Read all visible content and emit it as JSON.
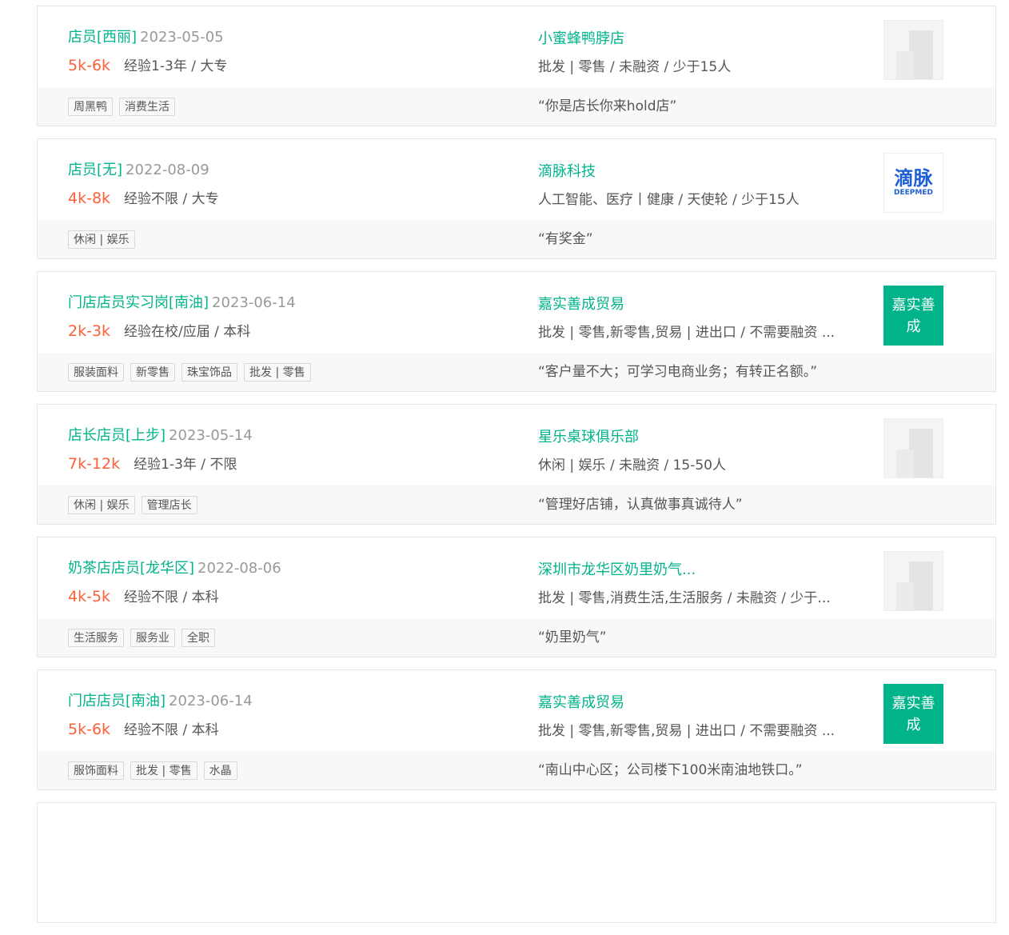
{
  "colors": {
    "accent": "#00b38a",
    "salary": "#fd5f39",
    "muted": "#999999",
    "text": "#555555",
    "tag_border": "#d8d8d8"
  },
  "jobs": [
    {
      "title": "店员[西丽]",
      "date": "2023-05-05",
      "salary": "5k-6k",
      "requirements": "经验1-3年 / 大专",
      "company": "小蜜蜂鸭脖店",
      "industry": "批发 | 零售 / 未融资 / 少于15人",
      "logo_type": "placeholder",
      "logo_icon": "company-logo-placeholder-icon",
      "tags": [
        "周黑鸭",
        "消费生活"
      ],
      "slogan": "“你是店长你来hold店”"
    },
    {
      "title": "店员[无]",
      "date": "2022-08-09",
      "salary": "4k-8k",
      "requirements": "经验不限 / 大专",
      "company": "滴脉科技",
      "industry": "人工智能、医疗丨健康 / 天使轮 / 少于15人",
      "logo_type": "text",
      "logo_text": "滴脉",
      "logo_subtext": "DEEPMED",
      "tags": [
        "休闲 | 娱乐"
      ],
      "slogan": "“有奖金”"
    },
    {
      "title": "门店店员实习岗[南油]",
      "date": "2023-06-14",
      "salary": "2k-3k",
      "requirements": "经验在校/应届 / 本科",
      "company": "嘉实善成贸易",
      "industry": "批发 | 零售,新零售,贸易 | 进出口 / 不需要融资 ...",
      "logo_type": "badge",
      "logo_text": "嘉实善成",
      "tags": [
        "服装面料",
        "新零售",
        "珠宝饰品",
        "批发 | 零售"
      ],
      "slogan": "“客户量不大；可学习电商业务；有转正名额。”"
    },
    {
      "title": "店长店员[上步]",
      "date": "2023-05-14",
      "salary": "7k-12k",
      "requirements": "经验1-3年 / 不限",
      "company": "星乐桌球俱乐部",
      "industry": "休闲 | 娱乐 / 未融资 / 15-50人",
      "logo_type": "placeholder",
      "logo_icon": "company-logo-placeholder-icon",
      "tags": [
        "休闲 | 娱乐",
        "管理店长"
      ],
      "slogan": "“管理好店铺，认真做事真诚待人”"
    },
    {
      "title": "奶茶店店员[龙华区]",
      "date": "2022-08-06",
      "salary": "4k-5k",
      "requirements": "经验不限 / 本科",
      "company": "深圳市龙华区奶里奶气...",
      "industry": "批发 | 零售,消费生活,生活服务 / 未融资 / 少于...",
      "logo_type": "placeholder",
      "logo_icon": "company-logo-placeholder-icon",
      "tags": [
        "生活服务",
        "服务业",
        "全职"
      ],
      "slogan": "“奶里奶气”"
    },
    {
      "title": "门店店员[南油]",
      "date": "2023-06-14",
      "salary": "5k-6k",
      "requirements": "经验不限 / 本科",
      "company": "嘉实善成贸易",
      "industry": "批发 | 零售,新零售,贸易 | 进出口 / 不需要融资 ...",
      "logo_type": "badge",
      "logo_text": "嘉实善成",
      "tags": [
        "服饰面料",
        "批发 | 零售",
        "水晶"
      ],
      "slogan": "“南山中心区；公司楼下100米南油地铁口。”"
    }
  ]
}
